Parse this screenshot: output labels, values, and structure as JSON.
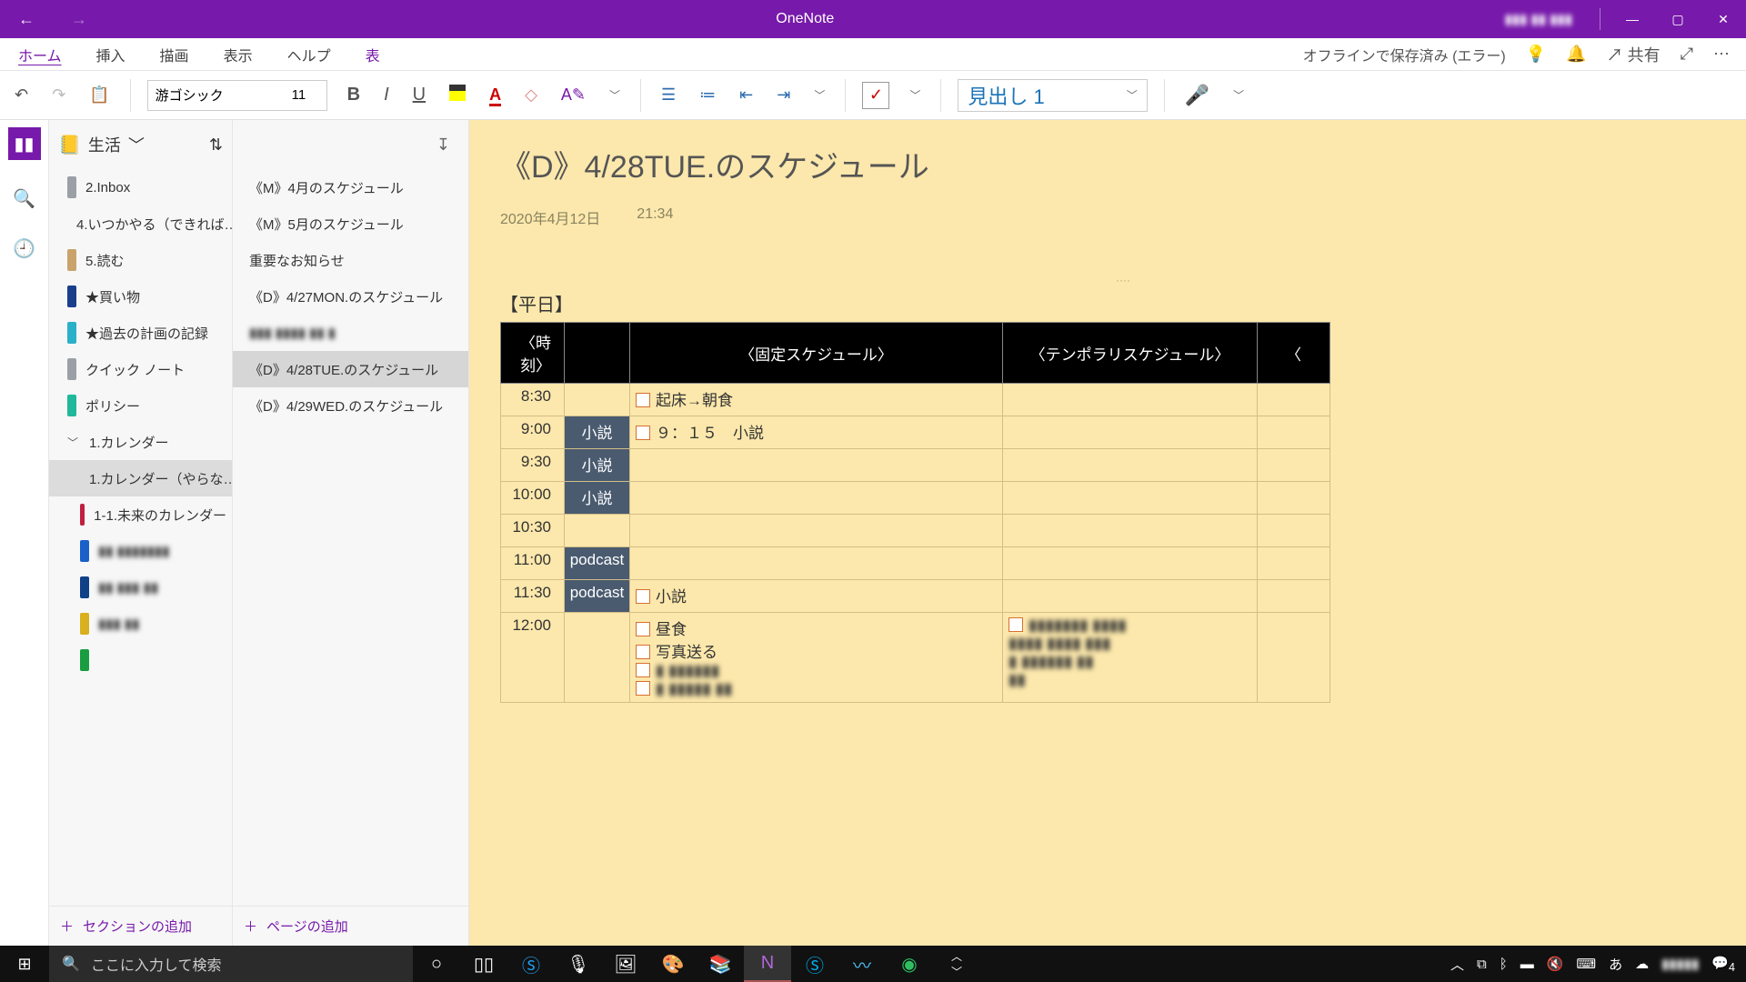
{
  "app": {
    "title": "OneNote",
    "user": "▮▮▮ ▮▮ ▮▮▮"
  },
  "window_buttons": {
    "min": "—",
    "max": "▢",
    "close": "✕"
  },
  "menubar": {
    "tabs": [
      "ホーム",
      "挿入",
      "描画",
      "表示",
      "ヘルプ",
      "表"
    ],
    "active_index": 5,
    "right": {
      "status": "オフラインで保存済み (エラー)",
      "share": "共有"
    }
  },
  "ribbon": {
    "font_name": "游ゴシック",
    "font_size": "11",
    "heading_style": "見出し 1"
  },
  "notebook": {
    "name": "生活",
    "add_section": "セクションの追加",
    "sections": [
      {
        "label": "2.Inbox",
        "color": "#9aa0a6",
        "indent": false
      },
      {
        "label": "4.いつかやる（できれば…",
        "color": "#7719AA",
        "indent": false
      },
      {
        "label": "5.読む",
        "color": "#c9a36b",
        "indent": false
      },
      {
        "label": "★買い物",
        "color": "#1a3e8c",
        "indent": false
      },
      {
        "label": "★過去の計画の記録",
        "color": "#2bb0c9",
        "indent": false
      },
      {
        "label": "クイック ノート",
        "color": "#9aa0a6",
        "indent": false
      },
      {
        "label": "ポリシー",
        "color": "#1fb89a",
        "indent": false
      },
      {
        "label": "1.カレンダー",
        "color": "",
        "indent": false,
        "expandable": true
      },
      {
        "label": "1.カレンダー（やらな…",
        "color": "#c02080",
        "indent": true,
        "selected": true
      },
      {
        "label": "1-1.未来のカレンダー",
        "color": "#c02040",
        "indent": true
      },
      {
        "label": "▮▮ ▮▮▮▮▮▮▮",
        "color": "#1a60c9",
        "indent": true,
        "blur": true
      },
      {
        "label": "▮▮ ▮▮▮ ▮▮",
        "color": "#104088",
        "indent": true,
        "blur": true
      },
      {
        "label": "▮▮▮ ▮▮",
        "color": "#d8b020",
        "indent": true,
        "blur": true
      },
      {
        "label": "",
        "color": "#1a9c40",
        "indent": true,
        "blur": true
      }
    ]
  },
  "pages": {
    "add_page": "ページの追加",
    "items": [
      {
        "label": "《M》4月のスケジュール"
      },
      {
        "label": "《M》5月のスケジュール"
      },
      {
        "label": "重要なお知らせ"
      },
      {
        "label": "《D》4/27MON.のスケジュール"
      },
      {
        "label": "▮▮▮ ▮▮▮▮ ▮▮ ▮",
        "blur": true
      },
      {
        "label": "《D》4/28TUE.のスケジュール",
        "selected": true
      },
      {
        "label": "《D》4/29WED.のスケジュール"
      }
    ]
  },
  "content": {
    "title": "《D》4/28TUE.のスケジュール",
    "date": "2020年4月12日",
    "time": "21:34",
    "section_heading": "【平日】",
    "columns": {
      "time": "〈時刻〉",
      "fixed": "〈固定スケジュール〉",
      "temp": "〈テンポラリスケジュール〉",
      "last": "〈"
    },
    "rows": [
      {
        "time": "8:30",
        "fixed1": "",
        "fixed2_cb": true,
        "fixed2": "起床→朝食"
      },
      {
        "time": "9:00",
        "fixed1": "小説",
        "fixed2_cb": true,
        "fixed2": "９：１５　小説"
      },
      {
        "time": "9:30",
        "fixed1": "小説",
        "fixed2_cb": false,
        "fixed2": ""
      },
      {
        "time": "10:00",
        "fixed1": "小説",
        "fixed2_cb": false,
        "fixed2": ""
      },
      {
        "time": "10:30",
        "fixed1": "",
        "fixed2_cb": false,
        "fixed2": ""
      },
      {
        "time": "11:00",
        "fixed1": "podcast",
        "fixed2_cb": false,
        "fixed2": ""
      },
      {
        "time": "11:30",
        "fixed1": "podcast",
        "fixed2_cb": true,
        "fixed2": "小説"
      },
      {
        "time": "12:00",
        "fixed1": "",
        "fixed2_cb": true,
        "fixed2_multi": [
          "昼食",
          "写真送る",
          "▮ ▮▮▮▮▮▮",
          "▮ ▮▮▮▮▮ ▮▮"
        ],
        "temp_cb": true,
        "temp_multi": [
          "▮▮▮▮▮▮▮ ▮▮▮▮",
          "▮▮▮▮ ▮▮▮▮ ▮▮▮",
          "▮ ▮▮▮▮▮▮ ▮▮",
          "▮▮"
        ]
      }
    ]
  },
  "taskbar": {
    "search_placeholder": "ここに入力して検索",
    "ime": "あ",
    "notif_count": "4"
  }
}
